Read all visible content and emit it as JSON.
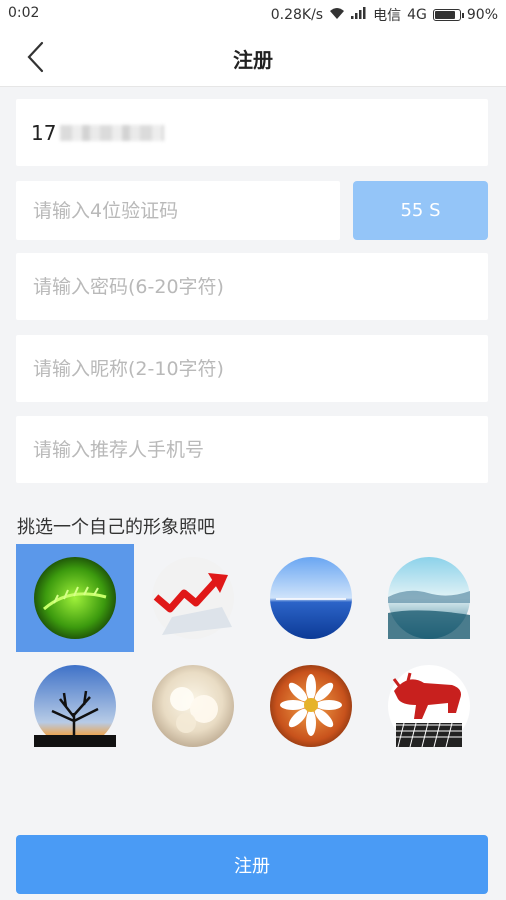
{
  "status_bar": {
    "time": "0:02",
    "net_speed": "0.28K/s",
    "carrier": "电信",
    "network": "4G",
    "battery": "90%",
    "battery_level": 0.9
  },
  "header": {
    "title": "注册"
  },
  "form": {
    "phone_prefix": "17",
    "code_placeholder": "请输入4位验证码",
    "code_button": "55 S",
    "password_placeholder": "请输入密码(6-20字符)",
    "nickname_placeholder": "请输入昵称(2-10字符)",
    "referrer_placeholder": "请输入推荐人手机号"
  },
  "avatar_section": {
    "label": "挑选一个自己的形象照吧",
    "items": [
      {
        "name": "green-fern",
        "selected": true
      },
      {
        "name": "red-arrow-chart",
        "selected": false
      },
      {
        "name": "blue-lake",
        "selected": false
      },
      {
        "name": "misty-mountains",
        "selected": false
      },
      {
        "name": "tree-silhouette",
        "selected": false
      },
      {
        "name": "white-flowers",
        "selected": false
      },
      {
        "name": "daisy",
        "selected": false
      },
      {
        "name": "red-bull",
        "selected": false
      }
    ]
  },
  "footer": {
    "register_button": "注册"
  },
  "colors": {
    "accent": "#4a9bf5",
    "accent_disabled": "#94c5f8",
    "selected_avatar_bg": "#5b98ea",
    "page_bg": "#f3f4f6"
  }
}
